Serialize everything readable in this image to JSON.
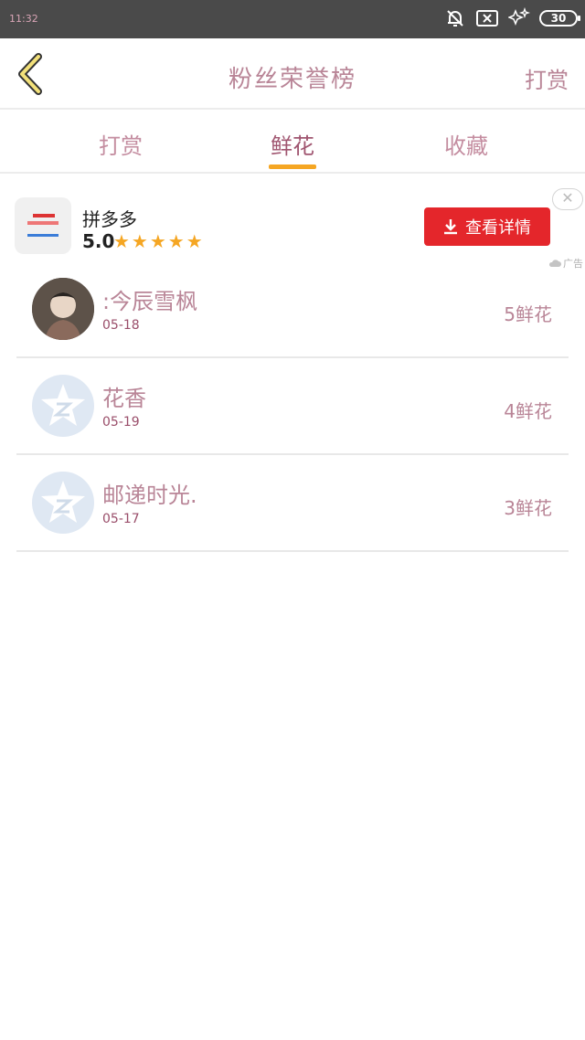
{
  "status_bar": {
    "time": "11:32",
    "battery": "30"
  },
  "header": {
    "title": "粉丝荣誉榜",
    "action_label": "打赏"
  },
  "tabs": [
    {
      "label": "打赏",
      "active": false
    },
    {
      "label": "鲜花",
      "active": true
    },
    {
      "label": "收藏",
      "active": false
    }
  ],
  "ad": {
    "app_name": "拼多多",
    "rating": "5.0",
    "stars": "★★★★★",
    "button_label": "查看详情",
    "close_glyph": "✕",
    "ad_label": "广告"
  },
  "fans": [
    {
      "name": ":今辰雪枫",
      "date": "05-18",
      "count": "5鲜花",
      "avatar": "photo"
    },
    {
      "name": "花香",
      "date": "05-19",
      "count": "4鲜花",
      "avatar": "default"
    },
    {
      "name": "邮递时光.",
      "date": "05-17",
      "count": "3鲜花",
      "avatar": "default"
    }
  ],
  "colors": {
    "accent": "#f5a623",
    "ad_button": "#e4262b",
    "text_pink": "#b98597"
  }
}
